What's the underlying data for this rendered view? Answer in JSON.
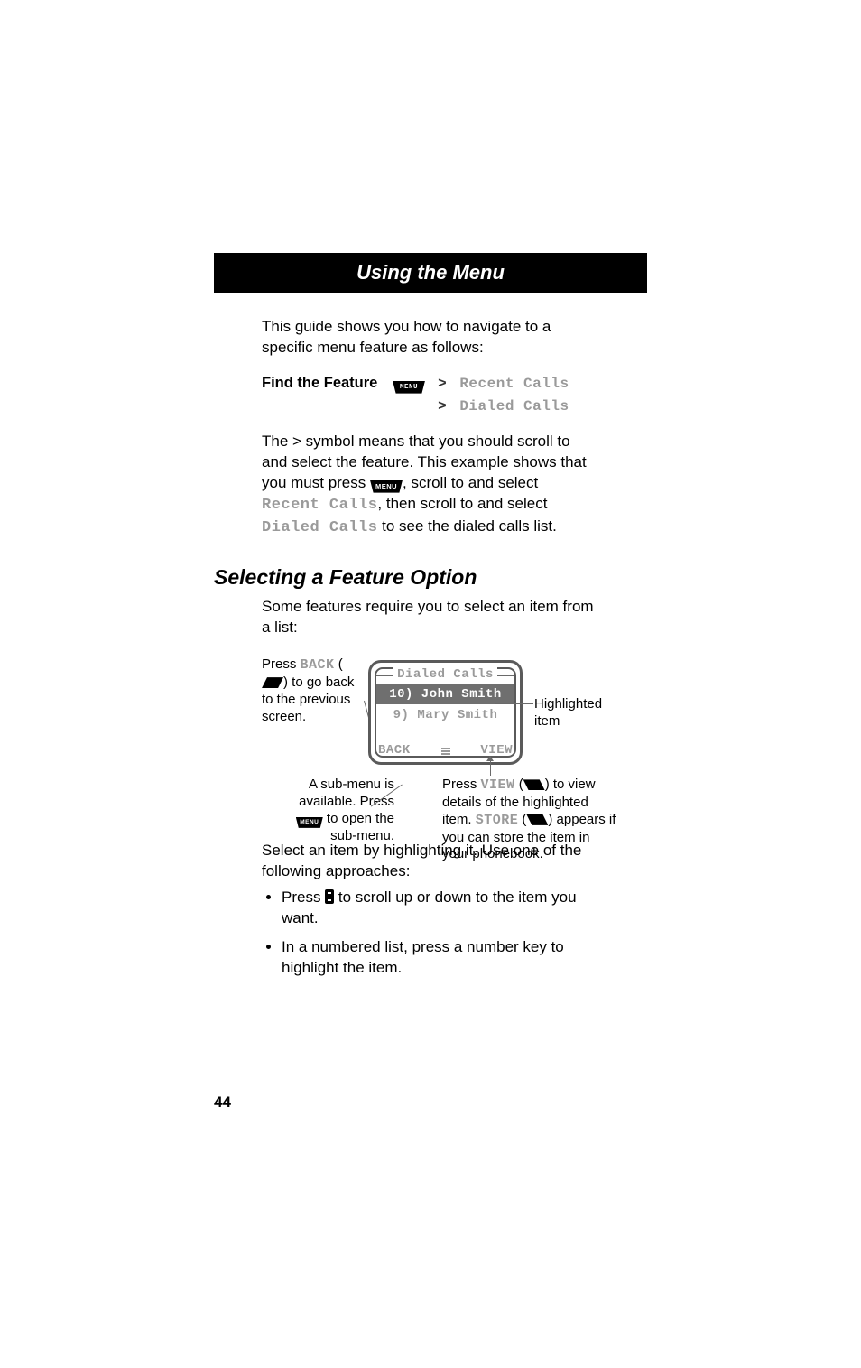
{
  "title": "Using the Menu",
  "intro": "This guide shows you how to navigate to a specific menu feature as follows:",
  "find_feature_label": "Find the Feature",
  "menu_key_text": "MENU",
  "nav_sep": ">",
  "nav_l1": "Recent Calls",
  "nav_l2": "Dialed Calls",
  "explain_a": "The > symbol means that you should scroll to and select the feature. This example shows that you must press ",
  "explain_b": ", scroll to and select ",
  "explain_term1": "Recent Calls",
  "explain_c": ", then scroll to and select ",
  "explain_term2": "Dialed Calls",
  "explain_d": " to see the dialed calls list.",
  "section_heading": "Selecting a Feature Option",
  "section_intro": "Some features require you to select an item from a list:",
  "fig": {
    "left_a": "Press ",
    "left_back": "BACK",
    "left_b": " (",
    "left_c": ") to go back to the previous screen.",
    "right_label": "Highlighted item",
    "submenu_a": "A sub-menu is available. Press ",
    "submenu_b": " to open the sub-menu.",
    "view_a": "Press ",
    "view_view": "VIEW",
    "view_b": " (",
    "view_c": ") to view details of the highlighted item. ",
    "view_store": "STORE",
    "view_d": " (",
    "view_e": ") appears if you can store the item in your phonebook.",
    "phone_title": "Dialed Calls",
    "phone_row1": "10) John Smith",
    "phone_row2": "9) Mary Smith",
    "soft_left": "BACK",
    "soft_right": "VIEW"
  },
  "select_instruction": "Select an item by highlighting it. Use one of the following approaches:",
  "bullet1_a": "Press ",
  "bullet1_b": " to scroll up or down to the item you want.",
  "bullet2": "In a numbered list, press a number key to highlight the item.",
  "page_number": "44"
}
